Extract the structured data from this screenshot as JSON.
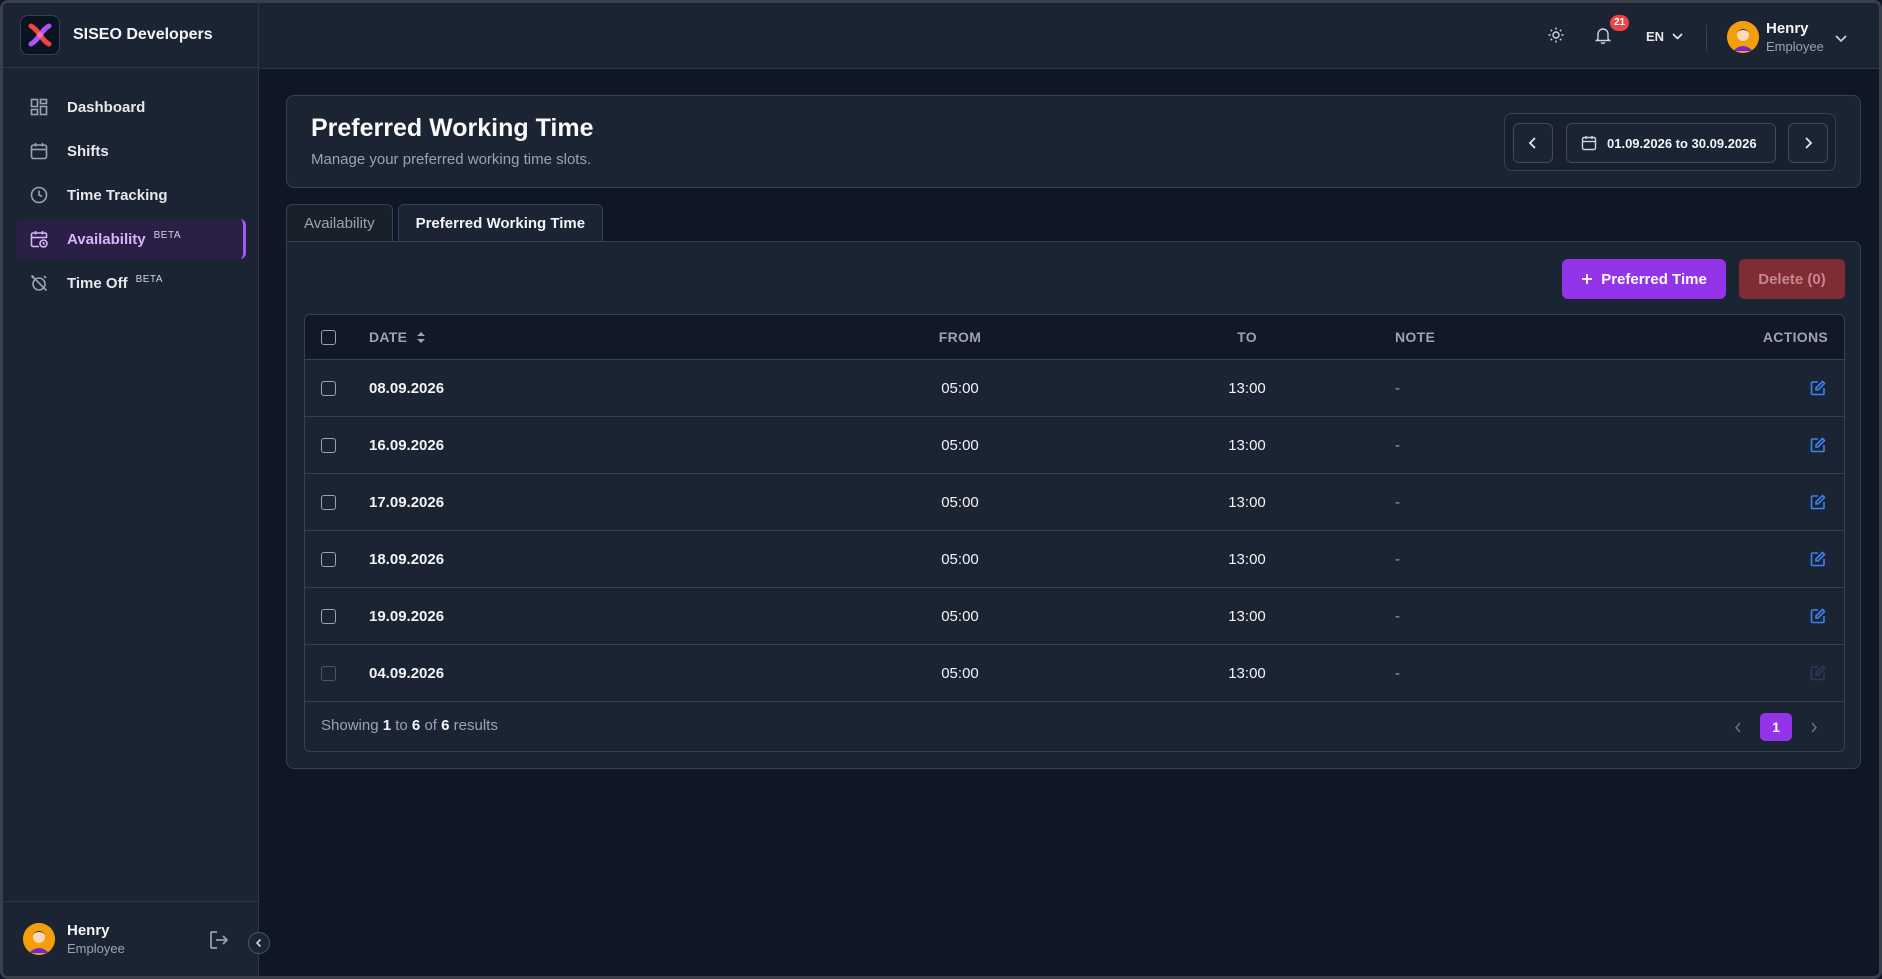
{
  "app": {
    "company": "SISEO Developers"
  },
  "sidebar": {
    "items": [
      {
        "label": "Dashboard",
        "icon": "dashboard-icon",
        "badge": ""
      },
      {
        "label": "Shifts",
        "icon": "calendar-icon",
        "badge": ""
      },
      {
        "label": "Time Tracking",
        "icon": "clock-icon",
        "badge": ""
      },
      {
        "label": "Availability",
        "icon": "calendar-clock-icon",
        "badge": "BETA",
        "active": true
      },
      {
        "label": "Time Off",
        "icon": "alarm-off-icon",
        "badge": "BETA"
      }
    ],
    "user": {
      "name": "Henry",
      "role": "Employee"
    }
  },
  "topbar": {
    "notifications": "21",
    "language": "EN",
    "user": {
      "name": "Henry",
      "role": "Employee"
    }
  },
  "header": {
    "title": "Preferred Working Time",
    "subtitle": "Manage your preferred working time slots.",
    "date_range": "01.09.2026 to 30.09.2026"
  },
  "tabs": [
    {
      "label": "Availability",
      "active": false
    },
    {
      "label": "Preferred Working Time",
      "active": true
    }
  ],
  "actions": {
    "add_label": "Preferred Time",
    "delete_label": "Delete (0)"
  },
  "table": {
    "columns": {
      "date": "DATE",
      "from": "FROM",
      "to": "TO",
      "note": "NOTE",
      "actions": "ACTIONS"
    },
    "rows": [
      {
        "date": "08.09.2026",
        "from": "05:00",
        "to": "13:00",
        "note": "-"
      },
      {
        "date": "16.09.2026",
        "from": "05:00",
        "to": "13:00",
        "note": "-"
      },
      {
        "date": "17.09.2026",
        "from": "05:00",
        "to": "13:00",
        "note": "-"
      },
      {
        "date": "18.09.2026",
        "from": "05:00",
        "to": "13:00",
        "note": "-"
      },
      {
        "date": "19.09.2026",
        "from": "05:00",
        "to": "13:00",
        "note": "-"
      },
      {
        "date": "04.09.2026",
        "from": "05:00",
        "to": "13:00",
        "note": "-",
        "disabled": true
      }
    ],
    "footer": {
      "showing": "Showing",
      "from": "1",
      "to_word": "to",
      "to": "6",
      "of_word": "of",
      "total": "6",
      "results": "results"
    },
    "page": "1"
  },
  "colors": {
    "accent": "#9333ea",
    "danger": "#7f2d35",
    "link": "#3b82f6",
    "badge": "#ef4444"
  }
}
